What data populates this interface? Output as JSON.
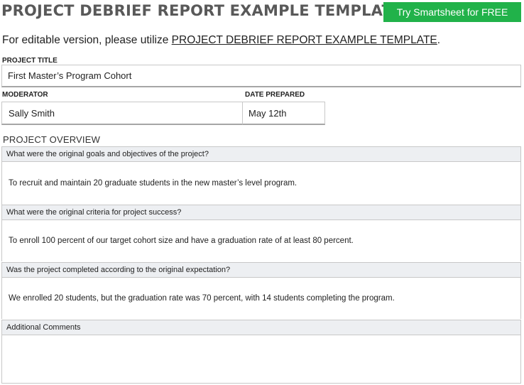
{
  "header": {
    "title": "PROJECT DEBRIEF REPORT EXAMPLE TEMPLATE",
    "cta_label": "Try Smartsheet for FREE",
    "cta_color": "#21b24a"
  },
  "intro": {
    "prefix": "For editable version, please utilize ",
    "link_text": "PROJECT DEBRIEF REPORT EXAMPLE TEMPLATE",
    "suffix": "."
  },
  "form": {
    "project_title_label": "PROJECT TITLE",
    "project_title_value": "First Master’s Program Cohort",
    "moderator_label": "MODERATOR",
    "moderator_value": "Sally Smith",
    "date_label": "DATE PREPARED",
    "date_value": "May 12th"
  },
  "overview": {
    "title": "PROJECT OVERVIEW",
    "items": [
      {
        "question": "What were the original goals and objectives of the project?",
        "answer": "To recruit and maintain 20 graduate students in the new master’s level program."
      },
      {
        "question": "What were the original criteria for project success?",
        "answer": "To enroll 100 percent of our target cohort size and have a graduation rate of at least 80 percent."
      },
      {
        "question": "Was the project completed according to the original expectation?",
        "answer": "We enrolled 20 students, but the graduation rate was 70 percent, with 14 students completing the program."
      },
      {
        "question": "Additional Comments",
        "answer": ""
      }
    ]
  }
}
